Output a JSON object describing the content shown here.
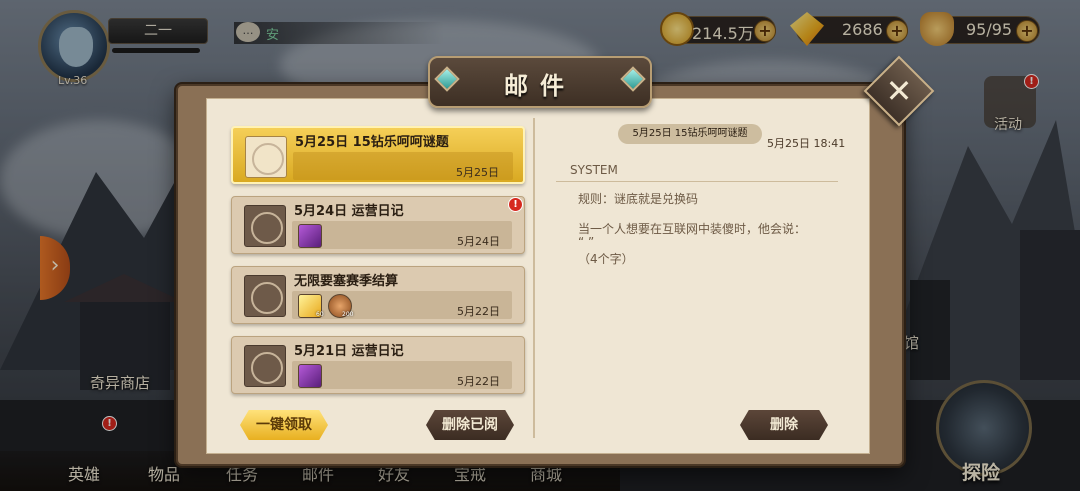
{
  "player": {
    "name": "二一",
    "level": "Lv.36"
  },
  "chat": {
    "icon": "chat-bubble-icon",
    "preview": "安"
  },
  "resources": {
    "gold": {
      "icon": "gold-coin-icon",
      "value": "214.5万"
    },
    "diamond": {
      "icon": "diamond-icon",
      "value": "2686"
    },
    "stamina": {
      "icon": "stamina-food-icon",
      "value": "95/95"
    }
  },
  "scene": {
    "shop_label": "奇异商店",
    "hall_label": "馆",
    "activity_label": "活动",
    "explore_label": "探险"
  },
  "nav": [
    "英雄",
    "物品",
    "任务",
    "邮件",
    "好友",
    "宝戒",
    "商城"
  ],
  "dialog": {
    "title": "邮件",
    "claim_all_label": "一键领取",
    "delete_read_label": "删除已阅",
    "delete_label": "删除"
  },
  "mails": [
    {
      "title": "5月25日 15钻乐呵呵谜题",
      "date": "5月25日",
      "selected": true,
      "has_alert": false,
      "attachments": []
    },
    {
      "title": "5月24日 运营日记",
      "date": "5月24日",
      "selected": false,
      "has_alert": true,
      "attachments": [
        {
          "icon": "purple-card-icon",
          "count": ""
        }
      ]
    },
    {
      "title": "无限要塞赛季结算",
      "date": "5月22日",
      "selected": false,
      "has_alert": false,
      "attachments": [
        {
          "icon": "diamond-icon",
          "count": "60"
        },
        {
          "icon": "bronze-medal-icon",
          "count": "200"
        }
      ]
    },
    {
      "title": "5月21日 运营日记",
      "date": "5月22日",
      "selected": false,
      "has_alert": false,
      "attachments": [
        {
          "icon": "purple-card-icon",
          "count": ""
        }
      ]
    }
  ],
  "detail": {
    "subject": "5月25日 15钻乐呵呵谜题",
    "datetime": "5月25日 18:41",
    "sender": "SYSTEM",
    "lines": [
      "规则：谜底就是兑换码",
      "当一个人想要在互联网中装傻时，他会说：",
      "“ ”",
      "（4个字）"
    ]
  },
  "colors": {
    "gold_accent": "#e8b020",
    "alert_red": "#d6291f",
    "paper": "#efe6d4"
  }
}
